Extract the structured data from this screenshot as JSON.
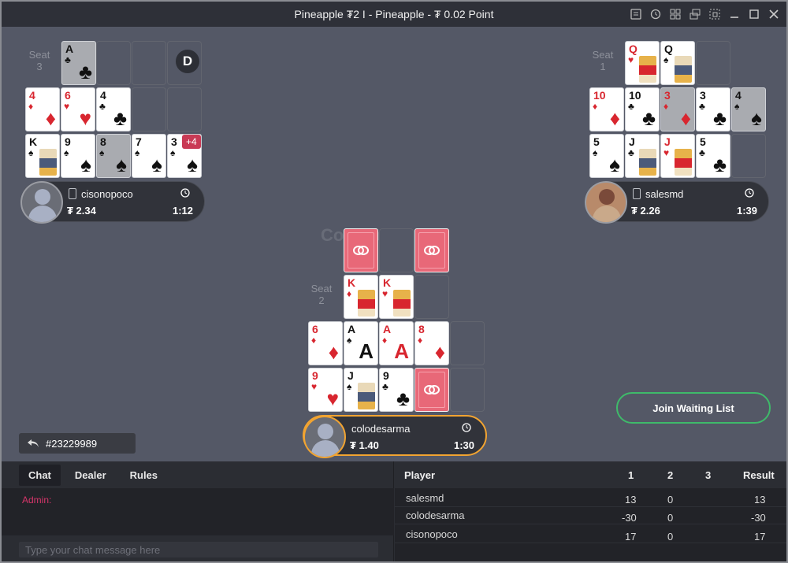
{
  "window": {
    "title": "Pineapple ₮2 I - Pineapple - ₮ 0.02 Point",
    "icons": [
      "list-icon",
      "history-icon",
      "grid-icon",
      "tables-icon",
      "popout-icon",
      "minimize-icon",
      "maximize-icon",
      "close-icon"
    ]
  },
  "table": {
    "watermark": "CoinPoker",
    "dealer": "D",
    "seats": {
      "seat3": {
        "label": "Seat\n3",
        "player": "cisonopoco",
        "stack": "₮ 2.34",
        "time": "1:12",
        "plus_badge": "+4",
        "rows": {
          "top": [
            {
              "rank": "A",
              "suit": "♣",
              "color": "black",
              "dim": true
            }
          ],
          "middle": [
            {
              "rank": "4",
              "suit": "♦",
              "color": "red"
            },
            {
              "rank": "6",
              "suit": "♥",
              "color": "red"
            },
            {
              "rank": "4",
              "suit": "♣",
              "color": "black"
            }
          ],
          "bottom": [
            {
              "rank": "K",
              "suit": "♠",
              "color": "black",
              "face": true
            },
            {
              "rank": "9",
              "suit": "♠",
              "color": "black"
            },
            {
              "rank": "8",
              "suit": "♠",
              "color": "black",
              "dim": true
            },
            {
              "rank": "7",
              "suit": "♠",
              "color": "black"
            },
            {
              "rank": "3",
              "suit": "♠",
              "color": "black"
            }
          ]
        }
      },
      "seat1": {
        "label": "Seat\n1",
        "player": "salesmd",
        "stack": "₮ 2.26",
        "time": "1:39",
        "rows": {
          "top": [
            {
              "rank": "Q",
              "suit": "♥",
              "color": "red",
              "face": true
            },
            {
              "rank": "Q",
              "suit": "♠",
              "color": "black",
              "face": true
            }
          ],
          "middle": [
            {
              "rank": "10",
              "suit": "♦",
              "color": "red"
            },
            {
              "rank": "10",
              "suit": "♣",
              "color": "black"
            },
            {
              "rank": "3",
              "suit": "♦",
              "color": "red",
              "dim": true
            },
            {
              "rank": "3",
              "suit": "♣",
              "color": "black"
            },
            {
              "rank": "4",
              "suit": "♠",
              "color": "black",
              "dim": true
            }
          ],
          "bottom": [
            {
              "rank": "5",
              "suit": "♠",
              "color": "black"
            },
            {
              "rank": "J",
              "suit": "♣",
              "color": "black",
              "face": true
            },
            {
              "rank": "J",
              "suit": "♥",
              "color": "red",
              "face": true
            },
            {
              "rank": "5",
              "suit": "♣",
              "color": "black"
            }
          ]
        }
      },
      "seat2": {
        "label": "Seat\n2",
        "player": "colodesarma",
        "stack": "₮ 1.40",
        "time": "1:30",
        "rows": {
          "top": [
            {
              "rank": "K",
              "suit": "♦",
              "color": "red",
              "face": true
            },
            {
              "rank": "K",
              "suit": "♥",
              "color": "red",
              "face": true
            }
          ],
          "middle": [
            {
              "rank": "6",
              "suit": "♦",
              "color": "red"
            },
            {
              "rank": "A",
              "suit": "♠",
              "color": "black",
              "letter": true
            },
            {
              "rank": "A",
              "suit": "♦",
              "color": "red",
              "letter": true
            },
            {
              "rank": "8",
              "suit": "♦",
              "color": "red"
            }
          ],
          "bottom": [
            {
              "rank": "9",
              "suit": "♥",
              "color": "red"
            },
            {
              "rank": "J",
              "suit": "♠",
              "color": "black",
              "face": true
            },
            {
              "rank": "9",
              "suit": "♣",
              "color": "black"
            }
          ]
        }
      }
    },
    "join_button": "Join Waiting List",
    "hand_id": "#23229989"
  },
  "chat": {
    "tabs": [
      "Chat",
      "Dealer",
      "Rules"
    ],
    "active_tab": "Chat",
    "admin_label": "Admin:",
    "input_placeholder": "Type your chat message here"
  },
  "scores": {
    "headers": [
      "Player",
      "1",
      "2",
      "3",
      "Result"
    ],
    "rows": [
      {
        "player": "salesmd",
        "r1": "13",
        "r2": "0",
        "r3": "",
        "result": "13"
      },
      {
        "player": "colodesarma",
        "r1": "-30",
        "r2": "0",
        "r3": "",
        "result": "-30"
      },
      {
        "player": "cisonopoco",
        "r1": "17",
        "r2": "0",
        "r3": "",
        "result": "17"
      }
    ]
  },
  "colors": {
    "felt": "#545866",
    "accent_active": "#f2a431",
    "join_border": "#3fba6a",
    "admin": "#d6356a",
    "card_back": "#e86878"
  }
}
